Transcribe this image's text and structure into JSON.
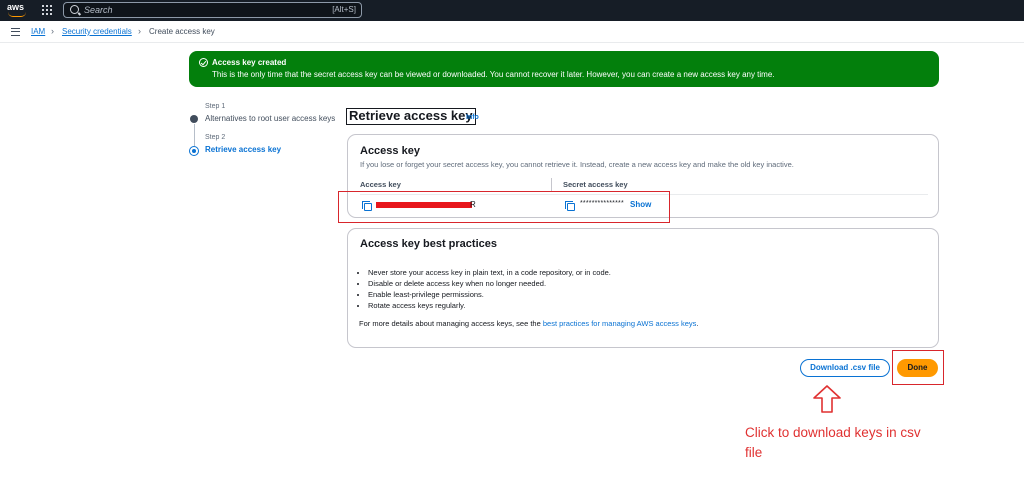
{
  "topnav": {
    "logo": "aws",
    "search_placeholder": "Search",
    "search_shortcut": "[Alt+S]"
  },
  "breadcrumb": {
    "items": [
      {
        "label": "IAM"
      },
      {
        "label": "Security credentials"
      },
      {
        "label": "Create access key"
      }
    ]
  },
  "flash": {
    "title": "Access key created",
    "message": "This is the only time that the secret access key can be viewed or downloaded. You cannot recover it later. However, you can create a new access key any time."
  },
  "steps": [
    {
      "caption": "Step 1",
      "label": "Alternatives to root user access keys",
      "state": "done"
    },
    {
      "caption": "Step 2",
      "label": "Retrieve access key",
      "state": "active"
    }
  ],
  "page": {
    "title": "Retrieve access key",
    "info": "Info"
  },
  "access_key": {
    "heading": "Access key",
    "description": "If you lose or forget your secret access key, you cannot retrieve it. Instead, create a new access key and make the old key inactive.",
    "col_access_key": "Access key",
    "col_secret_key": "Secret access key",
    "key_suffix": "R",
    "secret_mask": "***************",
    "show_label": "Show"
  },
  "best_practices": {
    "heading": "Access key best practices",
    "items": [
      "Never store your access key in plain text, in a code repository, or in code.",
      "Disable or delete access key when no longer needed.",
      "Enable least-privilege permissions.",
      "Rotate access keys regularly."
    ],
    "more_prefix": "For more details about managing access keys, see the ",
    "more_link": "best practices for managing AWS access keys",
    "more_suffix": "."
  },
  "actions": {
    "download_label": "Download .csv file",
    "done_label": "Done"
  },
  "annotation": {
    "text": "Click to download keys in csv file"
  },
  "colors": {
    "nav_bg": "#161d26",
    "success": "#037f0c",
    "link": "#0972d3",
    "primary_button": "#ff9900",
    "highlight": "#d8262c",
    "annotation": "#e03131"
  }
}
